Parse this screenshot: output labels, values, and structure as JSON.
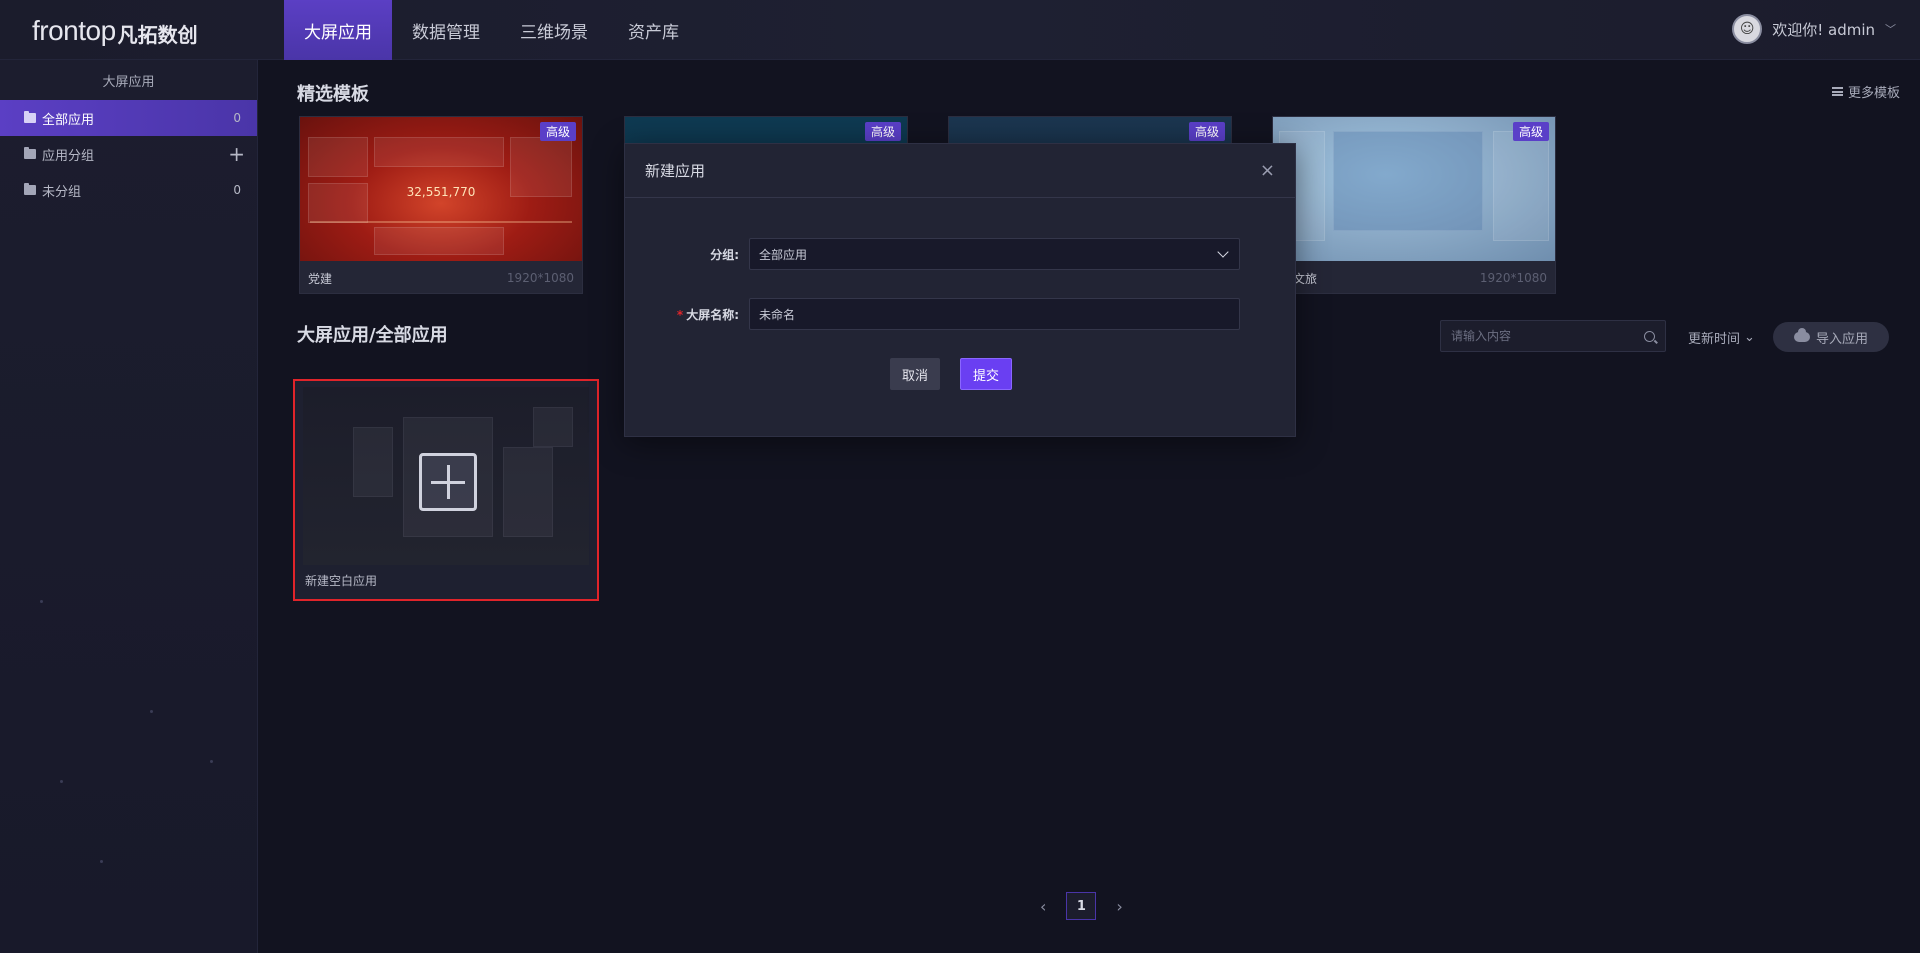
{
  "header": {
    "logo_en": "frontop",
    "logo_cn": "凡拓数创",
    "nav": [
      {
        "label": "大屏应用",
        "active": true
      },
      {
        "label": "数据管理",
        "active": false
      },
      {
        "label": "三维场景",
        "active": false
      },
      {
        "label": "资产库",
        "active": false
      }
    ],
    "user_greeting": "欢迎你! admin",
    "user_chevron": "﹀"
  },
  "sidebar": {
    "title": "大屏应用",
    "items": [
      {
        "label": "全部应用",
        "count": "0",
        "active": true
      },
      {
        "label": "应用分组",
        "action": "+",
        "active": false
      },
      {
        "label": "未分组",
        "count": "0",
        "active": false
      }
    ]
  },
  "main": {
    "featured_title": "精选模板",
    "more_templates": "更多模板",
    "templates": [
      {
        "name": "党建",
        "size": "1920*1080",
        "badge": "高级",
        "thumb_value": "32,551,770"
      },
      {
        "name": "",
        "size": "",
        "badge": "高级"
      },
      {
        "name": "",
        "size": "",
        "badge": "高级"
      },
      {
        "name": "慧文旅",
        "size": "1920*1080",
        "badge": "高级"
      }
    ],
    "apps_title": "大屏应用/全部应用",
    "search_placeholder": "请输入内容",
    "sort_label": "更新时间",
    "import_label": "导入应用",
    "new_app_label": "新建空白应用",
    "pager": {
      "prev": "‹",
      "page": "1",
      "next": "›"
    }
  },
  "dialog": {
    "title": "新建应用",
    "close": "×",
    "group_label": "分组:",
    "group_value": "全部应用",
    "name_required": "*",
    "name_label": "大屏名称:",
    "name_value": "未命名",
    "cancel": "取消",
    "submit": "提交"
  }
}
